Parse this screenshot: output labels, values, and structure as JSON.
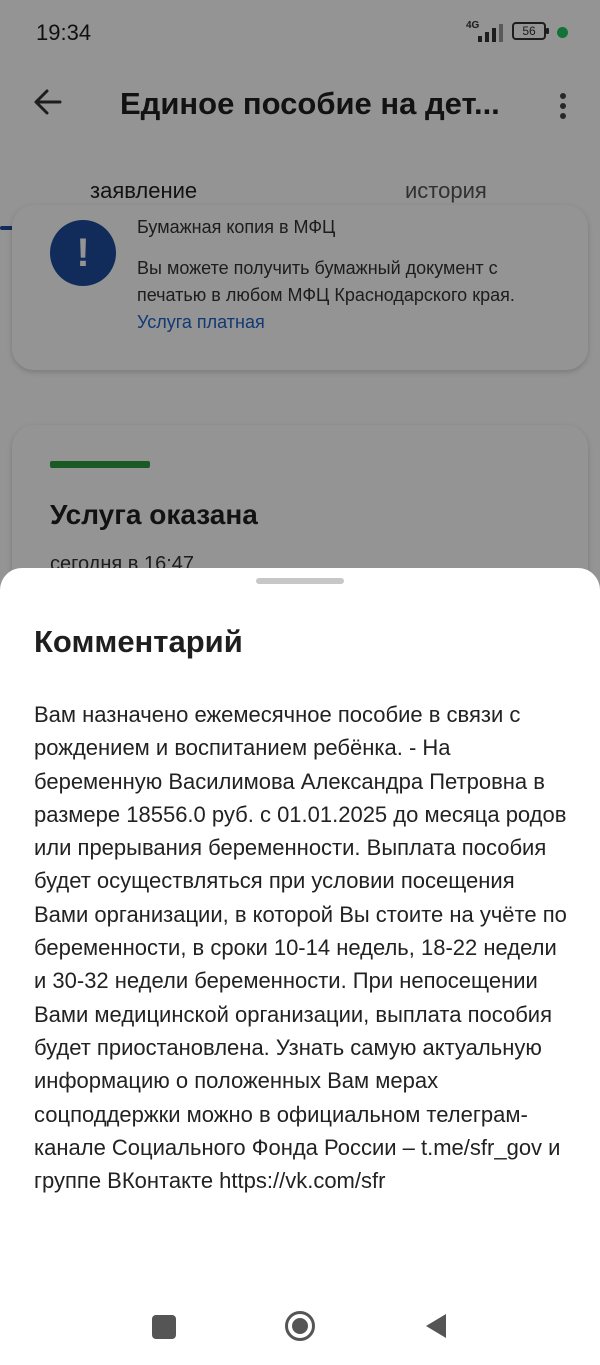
{
  "status_bar": {
    "time": "19:34",
    "network": "4G",
    "battery": "56"
  },
  "header": {
    "title": "Единое пособие на дет..."
  },
  "tabs": [
    {
      "label": "заявление",
      "active": true
    },
    {
      "label": "история",
      "active": false
    }
  ],
  "notice_card": {
    "heading": "Бумажная копия в МФЦ",
    "text": "Вы можете получить бумажный документ с печатью в любом МФЦ Краснодарского края.",
    "link": "Услуга платная"
  },
  "status_card": {
    "title": "Услуга оказана",
    "date": "сегодня в 16:47"
  },
  "comment": {
    "title": "Комментарий",
    "text": "Вам назначено ежемесячное пособие в связи с рождением и воспитанием ребёнка. - На беременную Василимова Александра Петровна в размере 18556.0 руб. с 01.01.2025 до месяца родов или прерывания беременности. Выплата пособия будет осуществляться при условии посещения Вами организации, в которой Вы стоите на учёте по беременности, в сроки 10-14 недель, 18-22 недели и 30-32 недели беременности. При непосещении Вами медицинской организации, выплата пособия будет приостановлена. Узнать самую актуальную информацию о положенных Вам мерах соцподдержки можно в официальном телеграм-канале Социального Фонда России – t.me/sfr_gov и группе ВКонтакте https://vk.com/sfr"
  },
  "colors": {
    "accent": "#1e4b9c",
    "link": "#1e63c8",
    "success": "#2e9b3e"
  },
  "icons": {
    "back": "arrow-left-icon",
    "menu": "more-vertical-icon",
    "alert": "exclamation-icon"
  }
}
